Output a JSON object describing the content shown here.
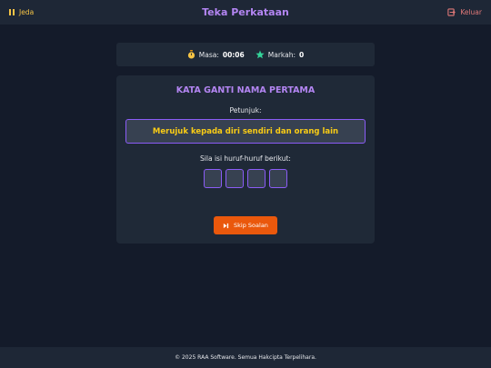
{
  "header": {
    "pause_label": "Jeda",
    "title": "Teka Perkataan",
    "exit_label": "Keluar"
  },
  "stats": {
    "time_label": "Masa:",
    "time_value": "00:06",
    "score_label": "Markah:",
    "score_value": "0"
  },
  "question": {
    "category": "KATA GANTI NAMA PERTAMA",
    "hint_label": "Petunjuk:",
    "hint_text": "Merujuk kepada diri sendiri dan orang lain",
    "fill_label": "Sila isi huruf-huruf berikut:",
    "letter_slots": [
      "",
      "",
      "",
      ""
    ]
  },
  "actions": {
    "skip_label": "Skip Soalan"
  },
  "footer": {
    "copyright": "© 2025 RAA Software. Semua Hakcipta Terpelihara."
  },
  "colors": {
    "background": "#141b2a",
    "panel": "#1f2937",
    "accent_purple": "#b385f2",
    "hint_yellow": "#facc15",
    "skip_orange": "#ea580c",
    "exit_red": "#e07878"
  },
  "icons": {
    "pause": "pause-icon",
    "exit": "exit-icon",
    "timer": "stopwatch-icon",
    "score": "star-icon",
    "skip": "skip-forward-icon"
  }
}
